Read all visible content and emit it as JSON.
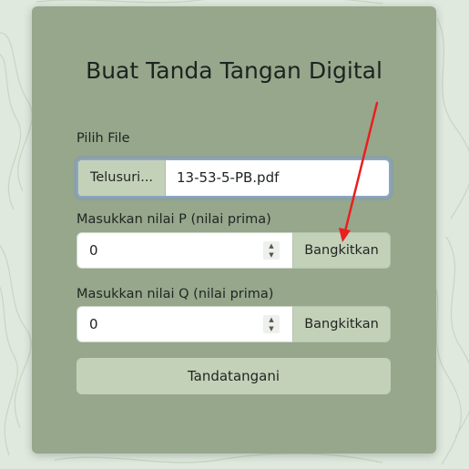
{
  "title": "Buat Tanda Tangan Digital",
  "file": {
    "label": "Pilih File",
    "browse_label": "Telusuri...",
    "selected_name": "13-53-5-PB.pdf"
  },
  "p_field": {
    "label": "Masukkan nilai P (nilai prima)",
    "value": "0",
    "generate_label": "Bangkitkan"
  },
  "q_field": {
    "label": "Masukkan nilai Q (nilai prima)",
    "value": "0",
    "generate_label": "Bangkitkan"
  },
  "sign_label": "Tandatangani",
  "colors": {
    "card": "#96a78c",
    "button": "#c4d1b9",
    "background": "#dfe9de",
    "annotation_arrow": "#e8201e"
  },
  "icons": [
    "spinner-up-icon",
    "spinner-down-icon",
    "red-arrow-annotation"
  ]
}
